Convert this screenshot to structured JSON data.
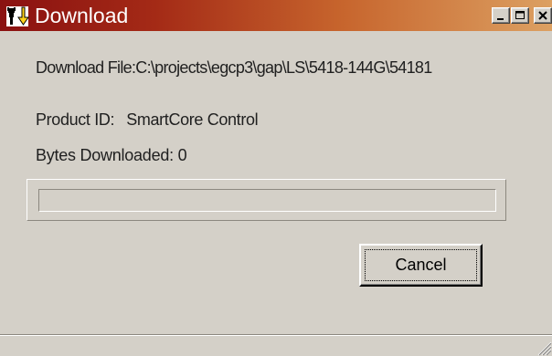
{
  "window": {
    "title": "Download",
    "controls": {
      "minimize": "minimize-icon",
      "maximize": "maximize-icon",
      "close": "close-icon"
    },
    "icon": "download-plug-icon"
  },
  "download": {
    "file_label": "Download File:",
    "file_path": "C:\\projects\\egcp3\\gap\\LS\\5418-144G\\54181",
    "product_label": "Product ID:",
    "product_value": "SmartCore Control",
    "bytes_label": "Bytes Downloaded:",
    "bytes_value": "0",
    "progress": 0
  },
  "actions": {
    "cancel_label": "Cancel"
  },
  "colors": {
    "titlebar_start": "#8a1111",
    "titlebar_end": "#dca062",
    "background": "#d4d0c8",
    "text": "#1f1f1f"
  }
}
